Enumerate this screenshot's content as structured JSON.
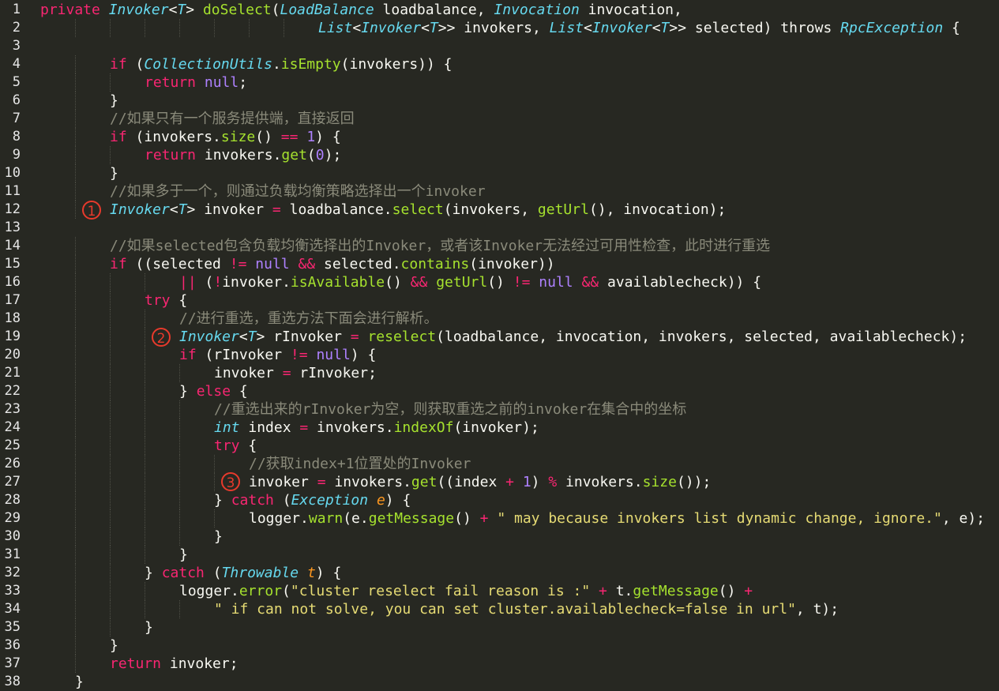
{
  "editor": {
    "theme": "monokai",
    "colors": {
      "background": "#272822",
      "keyword": "#f92672",
      "type": "#66d9ef",
      "function": "#a6e22e",
      "number": "#ae81ff",
      "string": "#e6db74",
      "comment": "#8a8a7a",
      "parameter": "#fd971f",
      "marker": "#e83a2c"
    },
    "line_numbers": [
      "1",
      "2",
      "3",
      "4",
      "5",
      "6",
      "7",
      "8",
      "9",
      "10",
      "11",
      "12",
      "13",
      "14",
      "15",
      "16",
      "17",
      "18",
      "19",
      "20",
      "21",
      "22",
      "23",
      "24",
      "25",
      "26",
      "27",
      "28",
      "29",
      "30",
      "31",
      "32",
      "33",
      "34",
      "35",
      "36",
      "37",
      "38"
    ],
    "markers": [
      "1",
      "2",
      "3"
    ],
    "lines": [
      {
        "indent": 0,
        "tokens": [
          [
            "kw",
            "private"
          ],
          [
            "txt",
            " "
          ],
          [
            "ty",
            "Invoker"
          ],
          [
            "txt",
            "<"
          ],
          [
            "ty",
            "T"
          ],
          [
            "txt",
            "> "
          ],
          [
            "fn",
            "doSelect"
          ],
          [
            "txt",
            "("
          ],
          [
            "ty",
            "LoadBalance"
          ],
          [
            "txt",
            " loadbalance, "
          ],
          [
            "ty",
            "Invocation"
          ],
          [
            "txt",
            " invocation,"
          ]
        ]
      },
      {
        "indent": 32,
        "tokens": [
          [
            "ty",
            "List"
          ],
          [
            "txt",
            "<"
          ],
          [
            "ty",
            "Invoker"
          ],
          [
            "txt",
            "<"
          ],
          [
            "ty",
            "T"
          ],
          [
            "txt",
            ">> invokers, "
          ],
          [
            "ty",
            "List"
          ],
          [
            "txt",
            "<"
          ],
          [
            "ty",
            "Invoker"
          ],
          [
            "txt",
            "<"
          ],
          [
            "ty",
            "T"
          ],
          [
            "txt",
            ">> selected) throws "
          ],
          [
            "ty",
            "RpcException"
          ],
          [
            "txt",
            " {"
          ]
        ]
      },
      {
        "indent": 0,
        "tokens": []
      },
      {
        "indent": 8,
        "tokens": [
          [
            "kw",
            "if"
          ],
          [
            "txt",
            " ("
          ],
          [
            "ty",
            "CollectionUtils"
          ],
          [
            "txt",
            "."
          ],
          [
            "fn",
            "isEmpty"
          ],
          [
            "txt",
            "(invokers)) {"
          ]
        ]
      },
      {
        "indent": 12,
        "tokens": [
          [
            "kw",
            "return"
          ],
          [
            "txt",
            " "
          ],
          [
            "num",
            "null"
          ],
          [
            "txt",
            ";"
          ]
        ]
      },
      {
        "indent": 8,
        "tokens": [
          [
            "txt",
            "}"
          ]
        ]
      },
      {
        "indent": 8,
        "tokens": [
          [
            "cm",
            "//如果只有一个服务提供端，直接返回"
          ]
        ]
      },
      {
        "indent": 8,
        "tokens": [
          [
            "kw",
            "if"
          ],
          [
            "txt",
            " (invokers."
          ],
          [
            "fn",
            "size"
          ],
          [
            "txt",
            "() "
          ],
          [
            "kw",
            "=="
          ],
          [
            "txt",
            " "
          ],
          [
            "num",
            "1"
          ],
          [
            "txt",
            ") {"
          ]
        ]
      },
      {
        "indent": 12,
        "tokens": [
          [
            "kw",
            "return"
          ],
          [
            "txt",
            " invokers."
          ],
          [
            "fn",
            "get"
          ],
          [
            "txt",
            "("
          ],
          [
            "num",
            "0"
          ],
          [
            "txt",
            ");"
          ]
        ]
      },
      {
        "indent": 8,
        "tokens": [
          [
            "txt",
            "}"
          ]
        ]
      },
      {
        "indent": 8,
        "tokens": [
          [
            "cm",
            "//如果多于一个，则通过负载均衡策略选择出一个invoker"
          ]
        ]
      },
      {
        "indent": 8,
        "tokens": [
          [
            "ty",
            "Invoker"
          ],
          [
            "txt",
            "<"
          ],
          [
            "ty",
            "T"
          ],
          [
            "txt",
            "> invoker "
          ],
          [
            "kw",
            "="
          ],
          [
            "txt",
            " loadbalance."
          ],
          [
            "fn",
            "select"
          ],
          [
            "txt",
            "(invokers, "
          ],
          [
            "fn",
            "getUrl"
          ],
          [
            "txt",
            "(), invocation);"
          ]
        ]
      },
      {
        "indent": 0,
        "tokens": []
      },
      {
        "indent": 8,
        "tokens": [
          [
            "cm",
            "//如果selected包含负载均衡选择出的Invoker，或者该Invoker无法经过可用性检查，此时进行重选"
          ]
        ]
      },
      {
        "indent": 8,
        "tokens": [
          [
            "kw",
            "if"
          ],
          [
            "txt",
            " ((selected "
          ],
          [
            "kw",
            "!="
          ],
          [
            "txt",
            " "
          ],
          [
            "num",
            "null"
          ],
          [
            "txt",
            " "
          ],
          [
            "kw",
            "&&"
          ],
          [
            "txt",
            " selected."
          ],
          [
            "fn",
            "contains"
          ],
          [
            "txt",
            "(invoker))"
          ]
        ]
      },
      {
        "indent": 16,
        "tokens": [
          [
            "kw",
            "||"
          ],
          [
            "txt",
            " ("
          ],
          [
            "kw",
            "!"
          ],
          [
            "txt",
            "invoker."
          ],
          [
            "fn",
            "isAvailable"
          ],
          [
            "txt",
            "() "
          ],
          [
            "kw",
            "&&"
          ],
          [
            "txt",
            " "
          ],
          [
            "fn",
            "getUrl"
          ],
          [
            "txt",
            "() "
          ],
          [
            "kw",
            "!="
          ],
          [
            "txt",
            " "
          ],
          [
            "num",
            "null"
          ],
          [
            "txt",
            " "
          ],
          [
            "kw",
            "&&"
          ],
          [
            "txt",
            " availablecheck)) {"
          ]
        ]
      },
      {
        "indent": 12,
        "tokens": [
          [
            "kw",
            "try"
          ],
          [
            "txt",
            " {"
          ]
        ]
      },
      {
        "indent": 16,
        "tokens": [
          [
            "cm",
            "//进行重选，重选方法下面会进行解析。"
          ]
        ]
      },
      {
        "indent": 16,
        "tokens": [
          [
            "ty",
            "Invoker"
          ],
          [
            "txt",
            "<"
          ],
          [
            "ty",
            "T"
          ],
          [
            "txt",
            "> rInvoker "
          ],
          [
            "kw",
            "="
          ],
          [
            "txt",
            " "
          ],
          [
            "fn",
            "reselect"
          ],
          [
            "txt",
            "(loadbalance, invocation, invokers, selected, availablecheck);"
          ]
        ]
      },
      {
        "indent": 16,
        "tokens": [
          [
            "kw",
            "if"
          ],
          [
            "txt",
            " (rInvoker "
          ],
          [
            "kw",
            "!="
          ],
          [
            "txt",
            " "
          ],
          [
            "num",
            "null"
          ],
          [
            "txt",
            ") {"
          ]
        ]
      },
      {
        "indent": 20,
        "tokens": [
          [
            "txt",
            "invoker "
          ],
          [
            "kw",
            "="
          ],
          [
            "txt",
            " rInvoker;"
          ]
        ]
      },
      {
        "indent": 16,
        "tokens": [
          [
            "txt",
            "} "
          ],
          [
            "kw",
            "else"
          ],
          [
            "txt",
            " {"
          ]
        ]
      },
      {
        "indent": 20,
        "tokens": [
          [
            "cm",
            "//重选出来的rInvoker为空，则获取重选之前的invoker在集合中的坐标"
          ]
        ]
      },
      {
        "indent": 20,
        "tokens": [
          [
            "ty",
            "int"
          ],
          [
            "txt",
            " index "
          ],
          [
            "kw",
            "="
          ],
          [
            "txt",
            " invokers."
          ],
          [
            "fn",
            "indexOf"
          ],
          [
            "txt",
            "(invoker);"
          ]
        ]
      },
      {
        "indent": 20,
        "tokens": [
          [
            "kw",
            "try"
          ],
          [
            "txt",
            " {"
          ]
        ]
      },
      {
        "indent": 24,
        "tokens": [
          [
            "cm",
            "//获取index+1位置处的Invoker"
          ]
        ]
      },
      {
        "indent": 24,
        "tokens": [
          [
            "txt",
            "invoker "
          ],
          [
            "kw",
            "="
          ],
          [
            "txt",
            " invokers."
          ],
          [
            "fn",
            "get"
          ],
          [
            "txt",
            "((index "
          ],
          [
            "kw",
            "+"
          ],
          [
            "txt",
            " "
          ],
          [
            "num",
            "1"
          ],
          [
            "txt",
            ") "
          ],
          [
            "kw",
            "%"
          ],
          [
            "txt",
            " invokers."
          ],
          [
            "fn",
            "size"
          ],
          [
            "txt",
            "());"
          ]
        ]
      },
      {
        "indent": 20,
        "tokens": [
          [
            "txt",
            "} "
          ],
          [
            "kw",
            "catch"
          ],
          [
            "txt",
            " ("
          ],
          [
            "ty",
            "Exception"
          ],
          [
            "txt",
            " "
          ],
          [
            "par",
            "e"
          ],
          [
            "txt",
            ") {"
          ]
        ]
      },
      {
        "indent": 24,
        "tokens": [
          [
            "txt",
            "logger."
          ],
          [
            "fn",
            "warn"
          ],
          [
            "txt",
            "(e."
          ],
          [
            "fn",
            "getMessage"
          ],
          [
            "txt",
            "() "
          ],
          [
            "kw",
            "+"
          ],
          [
            "txt",
            " "
          ],
          [
            "str",
            "\" may because invokers list dynamic change, ignore.\""
          ],
          [
            "txt",
            ", e);"
          ]
        ]
      },
      {
        "indent": 20,
        "tokens": [
          [
            "txt",
            "}"
          ]
        ]
      },
      {
        "indent": 16,
        "tokens": [
          [
            "txt",
            "}"
          ]
        ]
      },
      {
        "indent": 12,
        "tokens": [
          [
            "txt",
            "} "
          ],
          [
            "kw",
            "catch"
          ],
          [
            "txt",
            " ("
          ],
          [
            "ty",
            "Throwable"
          ],
          [
            "txt",
            " "
          ],
          [
            "par",
            "t"
          ],
          [
            "txt",
            ") {"
          ]
        ]
      },
      {
        "indent": 16,
        "tokens": [
          [
            "txt",
            "logger."
          ],
          [
            "fn",
            "error"
          ],
          [
            "txt",
            "("
          ],
          [
            "str",
            "\"cluster reselect fail reason is :\""
          ],
          [
            "txt",
            " "
          ],
          [
            "kw",
            "+"
          ],
          [
            "txt",
            " t."
          ],
          [
            "fn",
            "getMessage"
          ],
          [
            "txt",
            "() "
          ],
          [
            "kw",
            "+"
          ]
        ]
      },
      {
        "indent": 20,
        "tokens": [
          [
            "str",
            "\" if can not solve, you can set cluster.availablecheck=false in url\""
          ],
          [
            "txt",
            ", t);"
          ]
        ]
      },
      {
        "indent": 12,
        "tokens": [
          [
            "txt",
            "}"
          ]
        ]
      },
      {
        "indent": 8,
        "tokens": [
          [
            "txt",
            "}"
          ]
        ]
      },
      {
        "indent": 8,
        "tokens": [
          [
            "kw",
            "return"
          ],
          [
            "txt",
            " invoker;"
          ]
        ]
      },
      {
        "indent": 4,
        "tokens": [
          [
            "txt",
            "}"
          ]
        ]
      }
    ]
  }
}
